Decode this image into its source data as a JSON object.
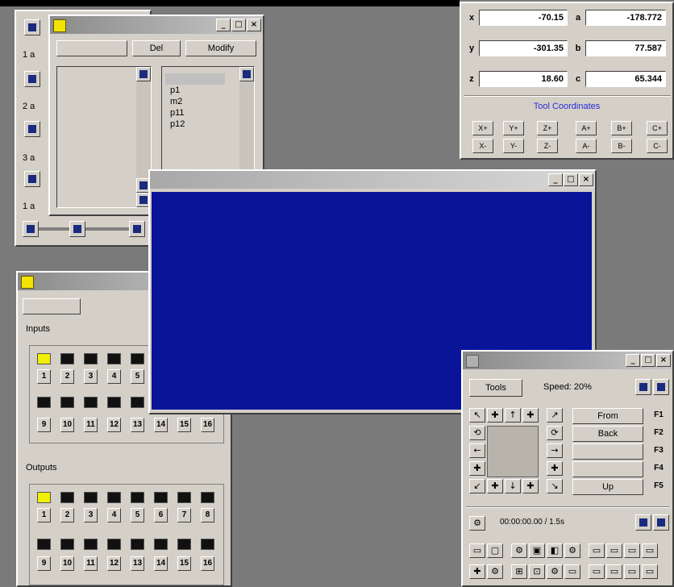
{
  "colors": {
    "desktop": "#7a7a7a",
    "face": "#d4d0c8",
    "viewport": "#0a1499",
    "led_on": "#f0f000",
    "led_off": "#111111",
    "link": "#2a2ad8"
  },
  "program_window": {
    "title": "",
    "buttons": {
      "left": "",
      "mid": "Del",
      "right": "Modify"
    },
    "list_items": [
      "",
      "p1",
      "m2",
      "p11",
      "p12"
    ],
    "side_labels": [
      "1 a",
      "2 a",
      "3 a",
      "1 a"
    ]
  },
  "viewport_window": {
    "title": "",
    "axis_marks": [
      "",
      "",
      "",
      ""
    ]
  },
  "io_window": {
    "title": "",
    "action_button": "",
    "inputs_label": "Inputs",
    "outputs_label": "Outputs",
    "inputs_row1": [
      "1",
      "2",
      "3",
      "4",
      "5"
    ],
    "inputs_row2": [
      "9",
      "10",
      "11",
      "12",
      "13",
      "14",
      "15",
      "16"
    ],
    "outputs_row1": [
      "1",
      "2",
      "3",
      "4",
      "5",
      "6",
      "7",
      "8"
    ],
    "outputs_row2": [
      "9",
      "10",
      "11",
      "12",
      "13",
      "14",
      "15",
      "16"
    ],
    "inputs_on": [
      true,
      false,
      false,
      false,
      false
    ],
    "outputs_on": [
      true,
      false,
      false,
      false,
      false,
      false,
      false,
      false
    ]
  },
  "coord_panel": {
    "rows": [
      {
        "l1": "x",
        "v1": "-70.15",
        "l2": "a",
        "v2": "-178.772"
      },
      {
        "l1": "y",
        "v1": "-301.35",
        "l2": "b",
        "v2": "77.587"
      },
      {
        "l1": "z",
        "v1": "18.60",
        "l2": "c",
        "v2": "65.344"
      }
    ],
    "link": "Tool Coordinates",
    "jog_plus": [
      "X+",
      "Y+",
      "Z+",
      "A+",
      "B+",
      "C+"
    ],
    "jog_minus": [
      "X-",
      "Y-",
      "Z-",
      "A-",
      "B-",
      "C-"
    ]
  },
  "jog_window": {
    "title": "",
    "mode_button": "Tools",
    "speed": "Speed: 20%",
    "mid_labels": [
      "",
      ""
    ],
    "actions": [
      {
        "label": "From",
        "key": "F1"
      },
      {
        "label": "Back",
        "key": "F2"
      },
      {
        "label": "",
        "key": "F3"
      },
      {
        "label": "",
        "key": "F4"
      },
      {
        "label": "Up",
        "key": "F5"
      }
    ],
    "time_readout": "00:00:00.00 / 1.5s"
  }
}
